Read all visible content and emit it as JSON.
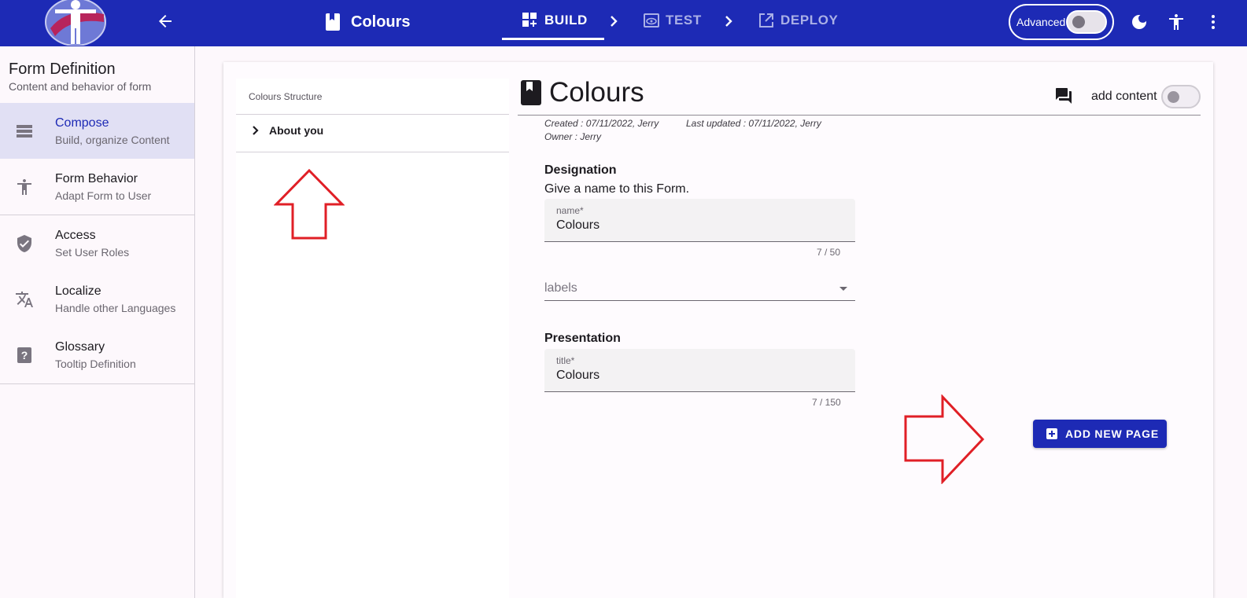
{
  "topbar": {
    "form_title": "Colours",
    "steps": [
      {
        "label": "BUILD",
        "active": true
      },
      {
        "label": "TEST",
        "active": false
      },
      {
        "label": "DEPLOY",
        "active": false
      }
    ],
    "advanced_label": "Advanced",
    "advanced_on": false,
    "background_color": "#1d2ab5"
  },
  "sidebar": {
    "title": "Form Definition",
    "subtitle": "Content and behavior of form",
    "items": [
      {
        "label": "Compose",
        "sublabel": "Build, organize Content",
        "icon": "compose-icon",
        "active": true
      },
      {
        "label": "Form Behavior",
        "sublabel": "Adapt Form to User",
        "icon": "accessibility-icon",
        "active": false
      },
      {
        "label": "Access",
        "sublabel": "Set User Roles",
        "icon": "shield-check-icon",
        "active": false
      },
      {
        "label": "Localize",
        "sublabel": "Handle other Languages",
        "icon": "translate-icon",
        "active": false
      },
      {
        "label": "Glossary",
        "sublabel": "Tooltip Definition",
        "icon": "help-icon",
        "active": false
      }
    ]
  },
  "structure": {
    "header": "Colours Structure",
    "nodes": [
      {
        "label": "About you"
      }
    ]
  },
  "main": {
    "title": "Colours",
    "add_content_label": "add content",
    "created": "Created : 07/11/2022, Jerry",
    "last_updated": "Last updated : 07/11/2022, Jerry",
    "owner": "Owner : Jerry",
    "designation": {
      "title": "Designation",
      "subtitle": "Give a name to this Form.",
      "name_label": "name*",
      "name_value": "Colours",
      "name_counter": "7 / 50",
      "labels_placeholder": "labels"
    },
    "presentation": {
      "title": "Presentation",
      "title_label": "title*",
      "title_value": "Colours",
      "title_counter": "7 / 150"
    },
    "add_page_label": "ADD NEW PAGE"
  }
}
